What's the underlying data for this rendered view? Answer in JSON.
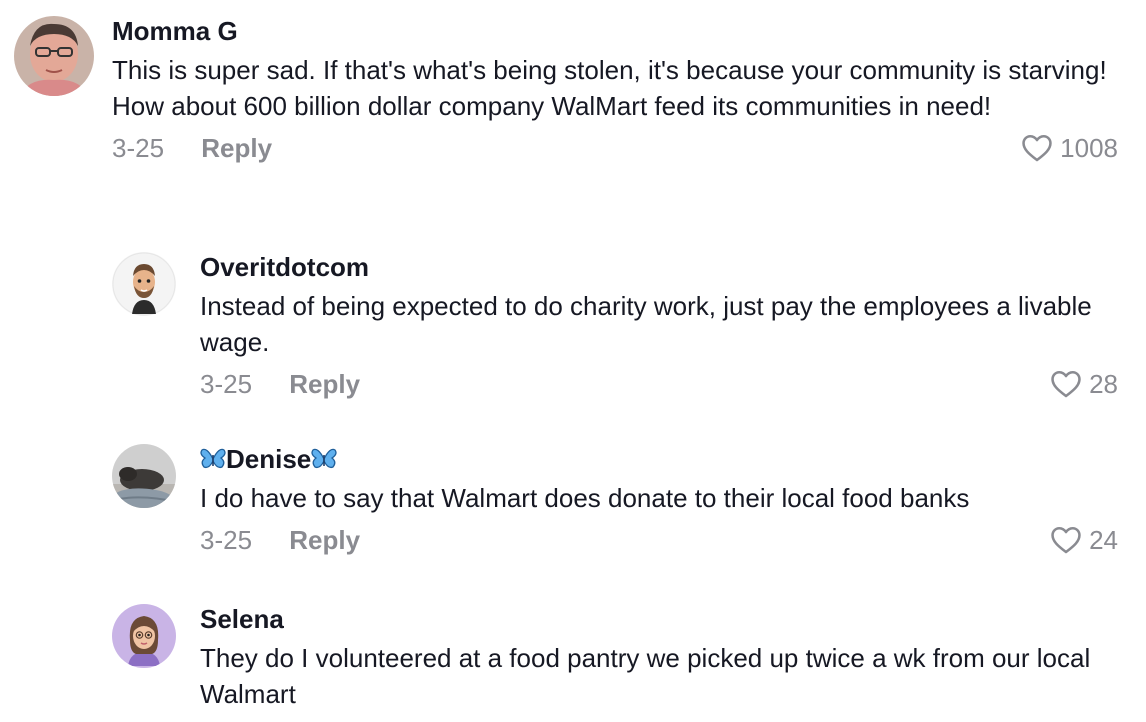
{
  "comments": [
    {
      "username": "Momma G",
      "text": "This is super sad. If that's what's being stolen, it's because your community is starving! How about 600 billion dollar company WalMart feed its communities in need!",
      "date": "3-25",
      "reply_label": "Reply",
      "likes": "1008"
    },
    {
      "username": "Overitdotcom",
      "text": "Instead of being expected to do charity work, just pay the employees a livable wage.",
      "date": "3-25",
      "reply_label": "Reply",
      "likes": "28"
    },
    {
      "username": "Denise",
      "text": "I do have to say that Walmart does donate to their local food banks",
      "date": "3-25",
      "reply_label": "Reply",
      "likes": "24"
    },
    {
      "username": "Selena",
      "text": "They do I volunteered at a food pantry we picked up twice a wk from our local Walmart"
    }
  ],
  "icons": {
    "like": "heart-outline-icon",
    "username_decoration": "butterfly-emoji"
  },
  "colors": {
    "text": "#161823",
    "secondary": "#8a8b91",
    "butterfly": "#3b8fd6"
  }
}
